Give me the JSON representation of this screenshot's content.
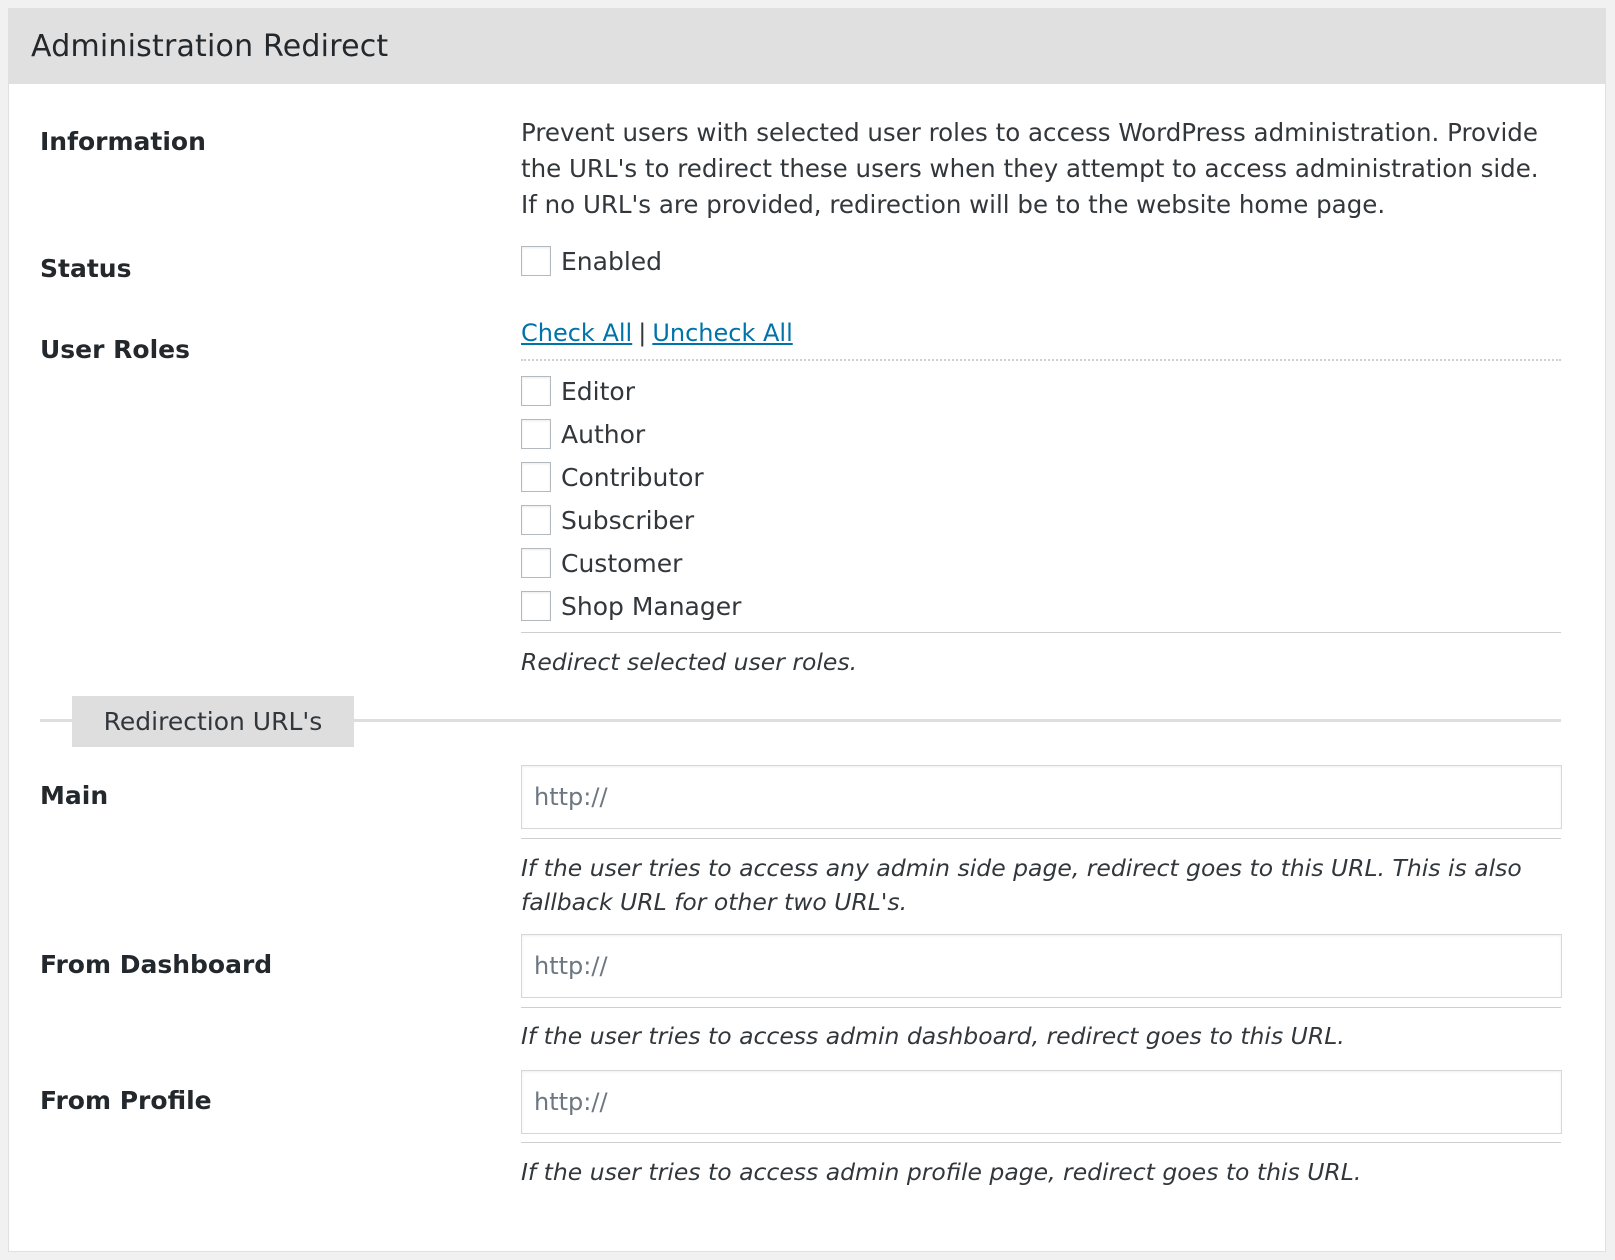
{
  "panel": {
    "title": "Administration Redirect"
  },
  "information": {
    "label": "Information",
    "text": "Prevent users with selected user roles to access WordPress administration. Provide the URL's to redirect these users when they attempt to access administration side. If no URL's are provided, redirection will be to the website home page."
  },
  "status": {
    "label": "Status",
    "checkbox_label": "Enabled",
    "checked": false
  },
  "user_roles": {
    "label": "User Roles",
    "check_all": "Check All",
    "separator": "|",
    "uncheck_all": "Uncheck All",
    "roles": [
      {
        "label": "Editor",
        "checked": false
      },
      {
        "label": "Author",
        "checked": false
      },
      {
        "label": "Contributor",
        "checked": false
      },
      {
        "label": "Subscriber",
        "checked": false
      },
      {
        "label": "Customer",
        "checked": false
      },
      {
        "label": "Shop Manager",
        "checked": false
      }
    ],
    "description": "Redirect selected user roles."
  },
  "redirection_section": {
    "title": "Redirection URL's"
  },
  "main_url": {
    "label": "Main",
    "placeholder": "http://",
    "value": "",
    "description": "If the user tries to access any admin side page, redirect goes to this URL. This is also fallback URL for other two URL's."
  },
  "dashboard_url": {
    "label": "From Dashboard",
    "placeholder": "http://",
    "value": "",
    "description": "If the user tries to access admin dashboard, redirect goes to this URL."
  },
  "profile_url": {
    "label": "From Profile",
    "placeholder": "http://",
    "value": "",
    "description": "If the user tries to access admin profile page, redirect goes to this URL."
  },
  "colors": {
    "header_bg": "#e0e0e0",
    "link": "#0073aa",
    "text": "#23282d"
  }
}
